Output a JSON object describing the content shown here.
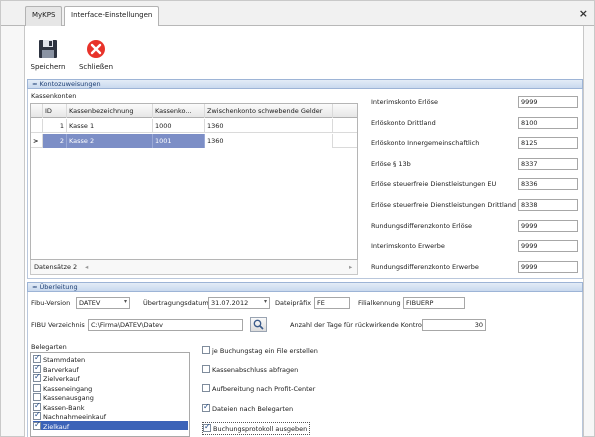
{
  "tabs": [
    "MyKPS",
    "Interface-Einstellungen"
  ],
  "close_glyph": "×",
  "toolbar": {
    "save_label": "Speichern",
    "close_label": "Schließen"
  },
  "kontozuweisungen": {
    "header": "Kontozuweisungen",
    "kassenkonten_label": "Kassenkonten",
    "columns": [
      "ID",
      "Kassenbezeichnung",
      "Kassenko...",
      "Zwischenkonto schwebende Gelder"
    ],
    "rows": [
      {
        "indicator": "",
        "id": "1",
        "name": "Kasse 1",
        "konto": "1000",
        "zwischen": "1360"
      },
      {
        "indicator": ">",
        "id": "2",
        "name": "Kasse 2",
        "konto": "1001",
        "zwischen": "1360"
      }
    ],
    "footer_label": "Datensätze 2",
    "footer_prev": "◂",
    "footer_next": "▸",
    "accounts": [
      {
        "label": "Interimskonto Erlöse",
        "value": "9999"
      },
      {
        "label": "Erlöskonto Drittland",
        "value": "8100"
      },
      {
        "label": "Erlöskonto Innergemeinschaftlich",
        "value": "8125"
      },
      {
        "label": "Erlöse § 13b",
        "value": "8337"
      },
      {
        "label": "Erlöse steuerfreie Dienstleistungen EU",
        "value": "8336"
      },
      {
        "label": "Erlöse steuerfreie Dienstleistungen Drittland",
        "value": "8338"
      },
      {
        "label": "Rundungsdifferenzkonto Erlöse",
        "value": "9999"
      },
      {
        "label": "Interimskonto Erwerbe",
        "value": "9999"
      },
      {
        "label": "Rundungsdifferenzkonto Erwerbe",
        "value": "9999"
      }
    ]
  },
  "ueberleitung": {
    "header": "Überleitung",
    "fibu_version_label": "Fibu-Version",
    "fibu_version_value": "DATEV",
    "uebertragungsdatum_label": "Übertragungsdatum",
    "uebertragungsdatum_value": "31.07.2012",
    "dateipraefix_label": "Dateipräfix",
    "dateipraefix_value": "FE",
    "filialkennung_label": "Filialkennung",
    "filialkennung_value": "FIBUERP",
    "verzeichnis_label": "FIBU Verzeichnis",
    "verzeichnis_value": "C:\\Firma\\DATEV\\Datev",
    "anzahl_label": "Anzahl der Tage für rückwirkende Kontrolle",
    "anzahl_value": "30",
    "belegarten_label": "Belegarten",
    "belegarten": [
      {
        "label": "Stammdaten",
        "checked": true
      },
      {
        "label": "Barverkauf",
        "checked": true
      },
      {
        "label": "Zielverkauf",
        "checked": true
      },
      {
        "label": "Kasseneingang",
        "checked": false
      },
      {
        "label": "Kassenausgang",
        "checked": false
      },
      {
        "label": "Kassen-Bank",
        "checked": true
      },
      {
        "label": "Nachnahmeeinkauf",
        "checked": true
      },
      {
        "label": "Zielkauf",
        "checked": true,
        "selected": true
      }
    ],
    "options": [
      {
        "label": "je Buchungstag ein File erstellen",
        "checked": false
      },
      {
        "label": "Kassenabschluss abfragen",
        "checked": false
      },
      {
        "label": "Aufbereitung nach Profit-Center",
        "checked": false
      },
      {
        "label": "Dateien nach Belegarten",
        "checked": true
      },
      {
        "label": "Buchungsprotokoll ausgeben",
        "checked": true
      }
    ]
  },
  "colors": {
    "selection": "#7c8ec6",
    "group_header": "#c9d9ee",
    "close_icon": "#e8332a"
  }
}
